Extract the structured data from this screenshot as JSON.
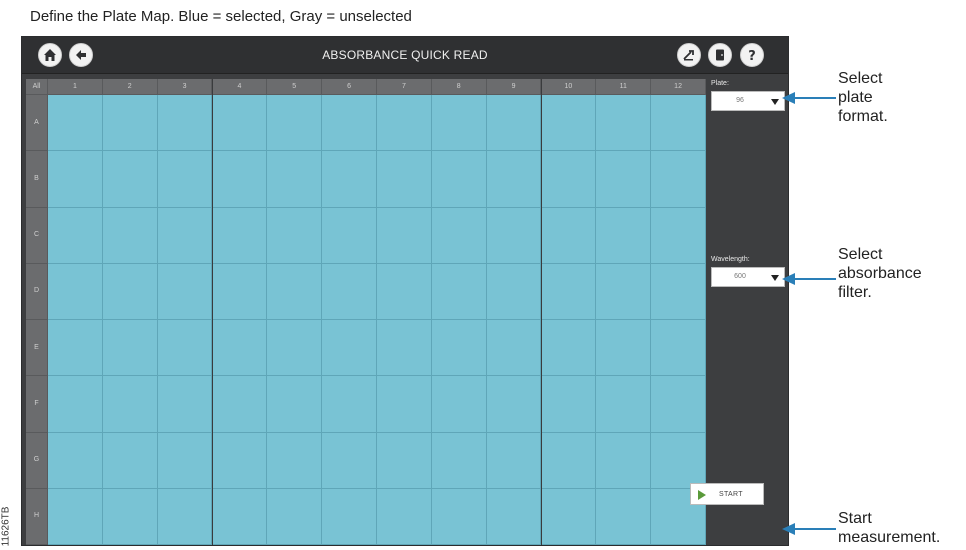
{
  "caption": "Define the Plate Map. Blue = selected, Gray = unselected",
  "figure_code": "11626TB",
  "window": {
    "title": "ABSORBANCE QUICK READ",
    "left_buttons": [
      "home-icon",
      "back-arrow-icon"
    ],
    "right_buttons": [
      "settings-tool-icon",
      "exit-door-icon",
      "help-icon"
    ]
  },
  "plate_map": {
    "corner_label": "All",
    "columns": [
      "1",
      "2",
      "3",
      "4",
      "5",
      "6",
      "7",
      "8",
      "9",
      "10",
      "11",
      "12"
    ],
    "rows": [
      "A",
      "B",
      "C",
      "D",
      "E",
      "F",
      "G",
      "H"
    ],
    "well_state": "selected",
    "colors": {
      "selected": "#79c3d4",
      "unselected": "#8e8f91",
      "header": "#6b6c6e",
      "app_background": "#3d3e40"
    }
  },
  "plate": {
    "label": "Plate:",
    "value": "96"
  },
  "wavelength": {
    "label": "Wavelength:",
    "value": "600"
  },
  "start_button": {
    "label": "START"
  },
  "callouts": {
    "plate": [
      "Select",
      "plate",
      "format."
    ],
    "filter": [
      "Select",
      "absorbance",
      "filter."
    ],
    "start": [
      "Start",
      "measurement."
    ]
  },
  "accent_color": "#2a7fb8"
}
